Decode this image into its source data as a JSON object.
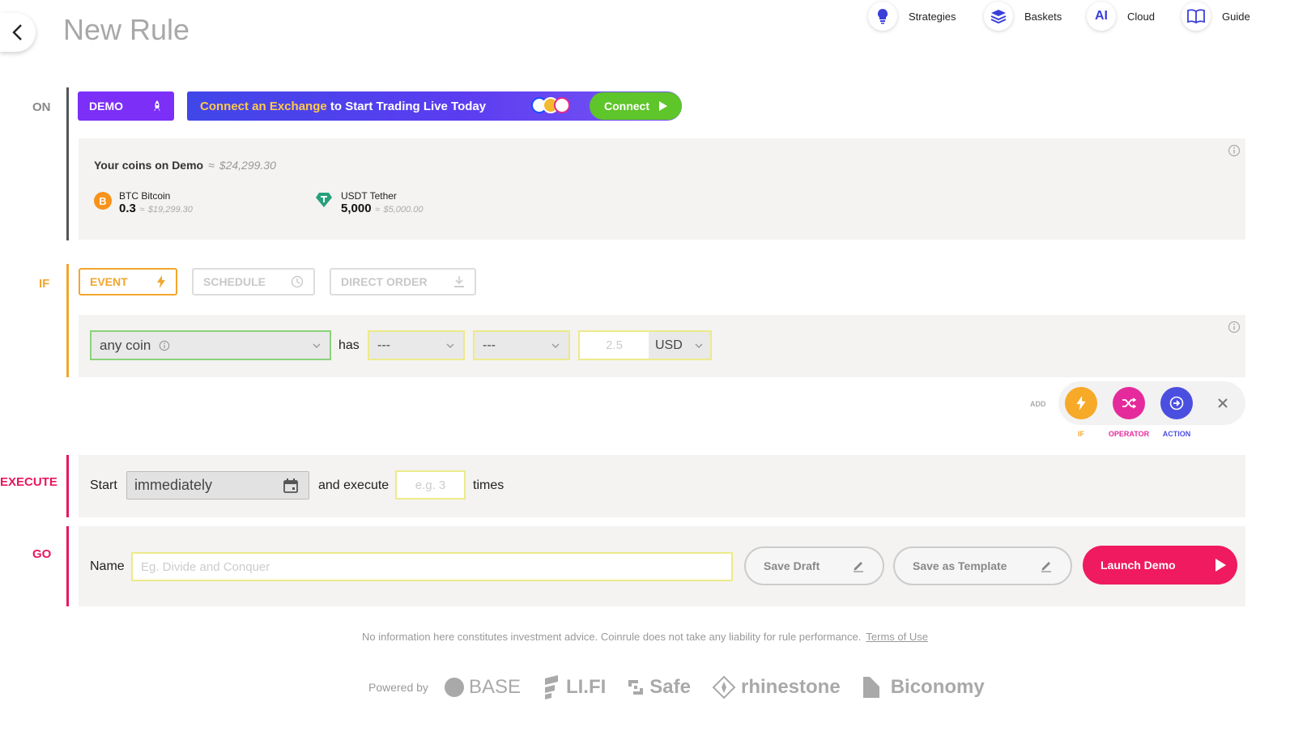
{
  "header": {
    "title": "New Rule",
    "nav": [
      {
        "label": "Strategies",
        "icon": "lightbulb-icon"
      },
      {
        "label": "Baskets",
        "icon": "layers-icon"
      },
      {
        "label": "Cloud",
        "icon": "ai-icon",
        "icon_text": "AI"
      },
      {
        "label": "Guide",
        "icon": "book-icon"
      }
    ]
  },
  "on": {
    "label": "ON",
    "demo_label": "DEMO",
    "banner_highlight": "Connect an Exchange",
    "banner_rest": " to Start Trading Live Today",
    "connect_label": "Connect",
    "coins_title": "Your coins on Demo",
    "approx": "≈",
    "total_value": "$24,299.30",
    "coins": [
      {
        "name": "BTC Bitcoin",
        "amount": "0.3",
        "value": "$19,299.30",
        "icon": "bitcoin-icon",
        "color": "#f7931a"
      },
      {
        "name": "USDT Tether",
        "amount": "5,000",
        "value": "$5,000.00",
        "icon": "tether-icon",
        "color": "#26a17b"
      }
    ]
  },
  "if": {
    "label": "IF",
    "tabs": [
      {
        "label": "EVENT",
        "icon": "lightning-icon",
        "active": true
      },
      {
        "label": "SCHEDULE",
        "icon": "clock-icon",
        "active": false
      },
      {
        "label": "DIRECT ORDER",
        "icon": "download-icon",
        "active": false
      }
    ],
    "coin_select": "any coin",
    "has_label": "has",
    "select_1": "---",
    "select_2": "---",
    "amount_placeholder": "2.5",
    "currency": "USD"
  },
  "add_bar": {
    "label": "ADD",
    "buttons": [
      {
        "label": "IF",
        "color": "#f7a928",
        "icon": "lightning-icon"
      },
      {
        "label": "OPERATOR",
        "color": "#e52a9b",
        "icon": "shuffle-icon"
      },
      {
        "label": "ACTION",
        "color": "#4b4fe0",
        "icon": "arrow-right-icon"
      }
    ]
  },
  "execute": {
    "label": "EXECUTE",
    "start_label": "Start",
    "start_value": "immediately",
    "and_execute": "and execute",
    "times_placeholder": "e.g. 3",
    "times_label": "times"
  },
  "go": {
    "label": "GO",
    "name_label": "Name",
    "name_placeholder": "Eg. Divide and Conquer",
    "save_draft": "Save Draft",
    "save_template": "Save as Template",
    "launch": "Launch Demo"
  },
  "footer": {
    "disclaimer": "No information here constitutes investment advice. Coinrule does not take any liability for rule performance.",
    "terms": "Terms of Use",
    "powered_by": "Powered by",
    "brands": [
      "BASE",
      "LI.FI",
      "Safe",
      "rhinestone",
      "Biconomy"
    ]
  },
  "colors": {
    "demo": "#7b2ff7",
    "on_bar": "#555555",
    "if": "#f2a62c",
    "execute": "#e8175d",
    "go": "#e8175d",
    "connect": "#5ec52a"
  }
}
